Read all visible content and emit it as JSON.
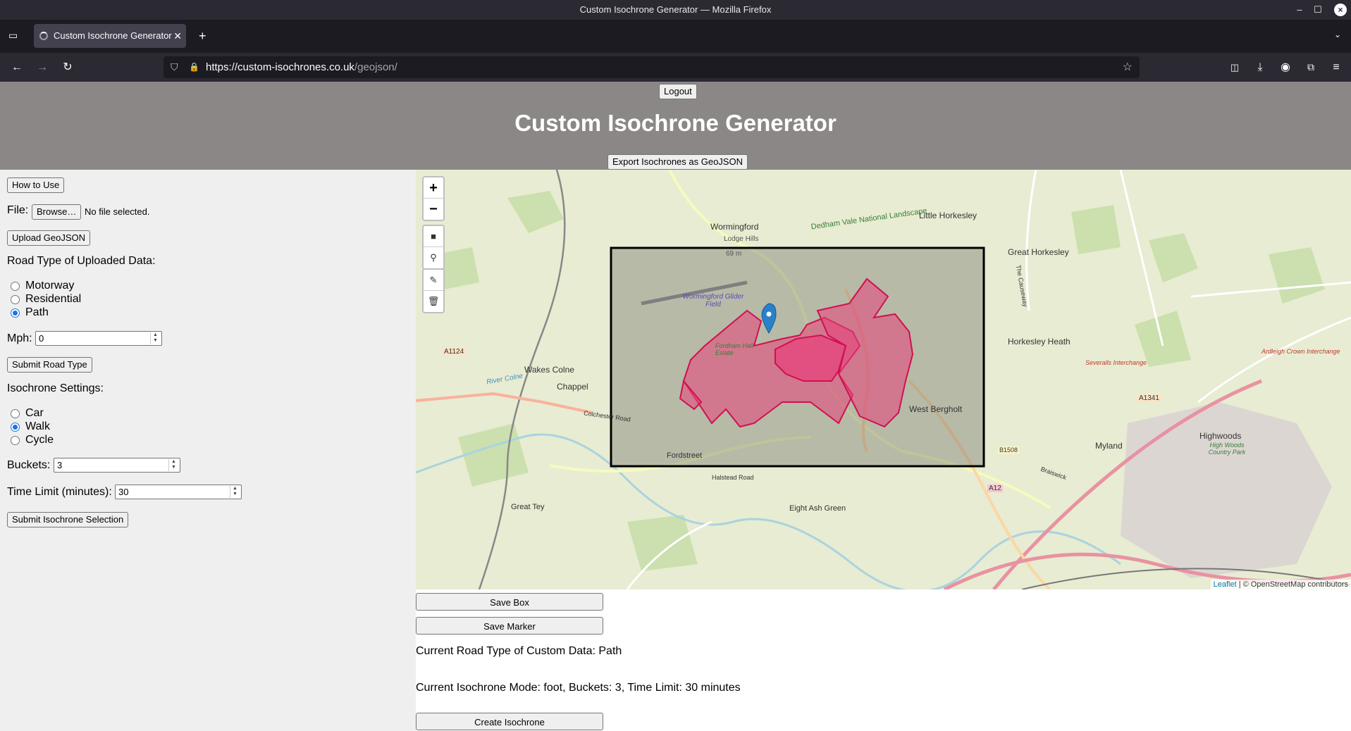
{
  "browser": {
    "window_title": "Custom Isochrone Generator — Mozilla Firefox",
    "tab_title": "Custom Isochrone Generator",
    "url_domain": "https://custom-isochrones.co.uk",
    "url_path": "/geojson/",
    "tab_close": "✕",
    "new_tab": "+"
  },
  "header": {
    "logout_label": "Logout",
    "title": "Custom Isochrone Generator",
    "export_label": "Export Isochrones as GeoJSON"
  },
  "sidebar": {
    "how_to_label": "How to Use",
    "file_label": "File:",
    "browse_label": "Browse…",
    "no_file_text": "No file selected.",
    "upload_label": "Upload GeoJSON",
    "road_type_heading": "Road Type of Uploaded Data:",
    "road_types": [
      {
        "label": "Motorway",
        "checked": false
      },
      {
        "label": "Residential",
        "checked": false
      },
      {
        "label": "Path",
        "checked": true
      }
    ],
    "mph_label": "Mph:",
    "mph_value": "0",
    "submit_road_label": "Submit Road Type",
    "iso_heading": "Isochrone Settings:",
    "modes": [
      {
        "label": "Car",
        "checked": false
      },
      {
        "label": "Walk",
        "checked": true
      },
      {
        "label": "Cycle",
        "checked": false
      }
    ],
    "buckets_label": "Buckets:",
    "buckets_value": "3",
    "time_label": "Time Limit (minutes):",
    "time_value": "30",
    "submit_iso_label": "Submit Isochrone Selection"
  },
  "map": {
    "zoom_in": "+",
    "zoom_out": "−",
    "attribution_link": "Leaflet",
    "attribution_text": " | © OpenStreetMap contributors",
    "place_labels": [
      "Wormingford",
      "Little Horkesley",
      "Great Horkesley",
      "Horkesley Heath",
      "Wakes Colne",
      "Chappel",
      "West Bergholt",
      "Fordstreet",
      "Myland",
      "Highwoods",
      "Great Tey",
      "Eight Ash Green",
      "Wormingford Glider Field",
      "Lodge Hills",
      "69 m",
      "Dedham Vale National Landscape",
      "Colchester Road",
      "Severalls Interchange",
      "Ardleigh Crown Interchange",
      "A1124",
      "A12",
      "A1341",
      "B1508",
      "River Colne",
      "Halstead Road",
      "Fordham Hall Estate",
      "The Causeway",
      "Braiswick",
      "High Woods Country Park"
    ],
    "colors": {
      "isochrone_fill": "#e8407a",
      "isochrone_stroke": "#d01050",
      "box_stroke": "#000000",
      "marker": "#2a81cb"
    }
  },
  "actions": {
    "save_box_label": "Save Box",
    "save_marker_label": "Save Marker",
    "road_type_status": "Current Road Type of Custom Data: Path",
    "mode_status": "Current Isochrone Mode: foot, Buckets: 3, Time Limit: 30 minutes",
    "create_label": "Create Isochrone"
  }
}
